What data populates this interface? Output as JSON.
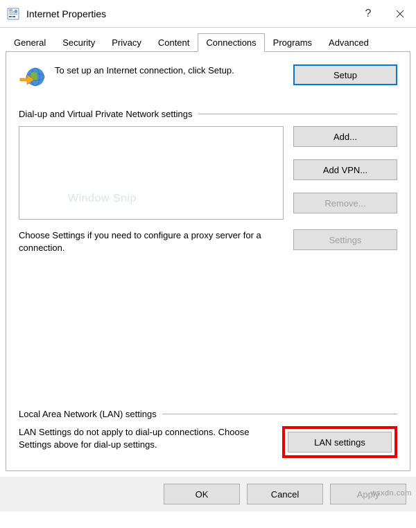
{
  "window": {
    "title": "Internet Properties"
  },
  "tabs": {
    "general": "General",
    "security": "Security",
    "privacy": "Privacy",
    "content": "Content",
    "connections": "Connections",
    "programs": "Programs",
    "advanced": "Advanced"
  },
  "setup": {
    "text": "To set up an Internet connection, click Setup.",
    "button": "Setup"
  },
  "dialup": {
    "title": "Dial-up and Virtual Private Network settings",
    "add": "Add...",
    "addVpn": "Add VPN...",
    "remove": "Remove...",
    "settings": "Settings",
    "desc": "Choose Settings if you need to configure a proxy server for a connection.",
    "snip": "Window Snip"
  },
  "lan": {
    "title": "Local Area Network (LAN) settings",
    "desc": "LAN Settings do not apply to dial-up connections. Choose Settings above for dial-up settings.",
    "button": "LAN settings"
  },
  "footer": {
    "ok": "OK",
    "cancel": "Cancel",
    "apply": "Apply"
  },
  "watermark": "wsxdn.com"
}
